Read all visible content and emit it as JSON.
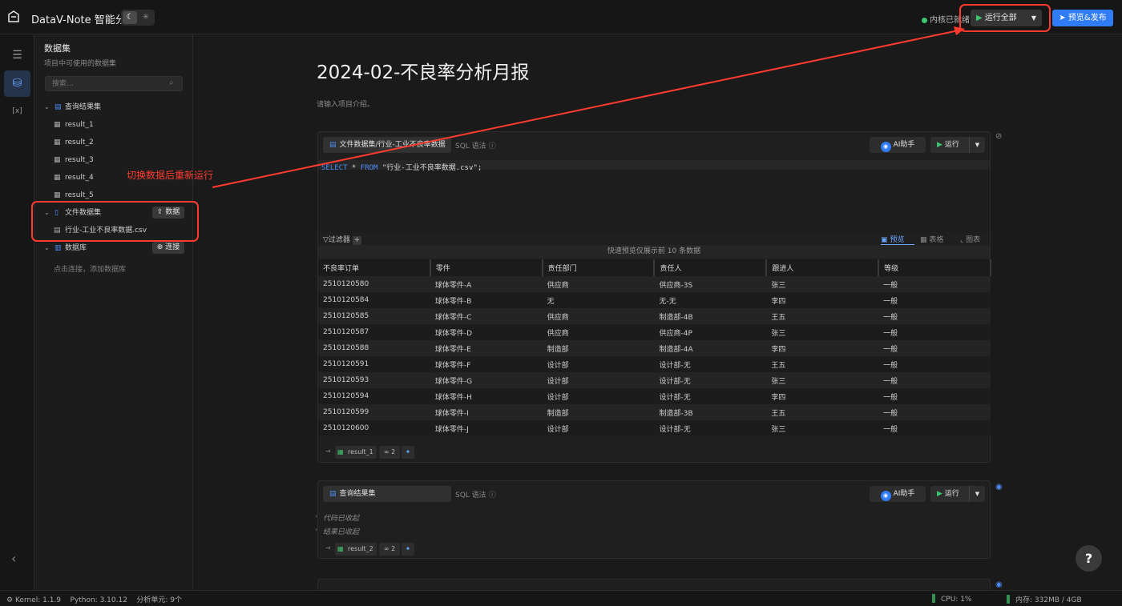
{
  "app": {
    "title": "DataV-Note 智能分析"
  },
  "header": {
    "kernel_status": "内核已就绪",
    "run_all_label": "运行全部",
    "publish_label": "预览&发布"
  },
  "sidebar": {
    "title": "数据集",
    "subtitle": "项目中可使用的数据集",
    "search_placeholder": "搜索...",
    "query_group": "查询结果集",
    "query_items": [
      "result_1",
      "result_2",
      "result_3",
      "result_4",
      "result_5"
    ],
    "file_group": "文件数据集",
    "file_upload_label": "数据",
    "file_items": [
      "行业-工业不良率数据.csv"
    ],
    "db_group": "数据库",
    "db_connect_label": "连接",
    "db_hint": "点击连接，添加数据库"
  },
  "document": {
    "title": "2024-02-不良率分析月报",
    "intro_placeholder": "请输入项目介绍。"
  },
  "cell1": {
    "source_tab": "文件数据集/行业-工业不良率数据",
    "mode_label": "SQL 语法",
    "ai_label": "AI助手",
    "run_label": "运行",
    "code": {
      "kw1": "SELECT",
      "star": " * ",
      "kw2": "FROM",
      "str": " \"行业-工业不良率数据.csv\";"
    },
    "filter_label": "过滤器",
    "views": {
      "preview": "预览",
      "table": "表格",
      "chart": "图表"
    },
    "preview_note": "快速预览仅展示前 10 条数据",
    "columns": [
      "不良率订单",
      "零件",
      "责任部门",
      "责任人",
      "跟进人",
      "等级"
    ],
    "rows": [
      [
        "2510120580",
        "球体零件-A",
        "供应商",
        "供应商-3S",
        "张三",
        "一般"
      ],
      [
        "2510120584",
        "球体零件-B",
        "无",
        "无-无",
        "李四",
        "一般"
      ],
      [
        "2510120585",
        "球体零件-C",
        "供应商",
        "制造部-4B",
        "王五",
        "一般"
      ],
      [
        "2510120587",
        "球体零件-D",
        "供应商",
        "供应商-4P",
        "张三",
        "一般"
      ],
      [
        "2510120588",
        "球体零件-E",
        "制造部",
        "制造部-4A",
        "李四",
        "一般"
      ],
      [
        "2510120591",
        "球体零件-F",
        "设计部",
        "设计部-无",
        "王五",
        "一般"
      ],
      [
        "2510120593",
        "球体零件-G",
        "设计部",
        "设计部-无",
        "张三",
        "一般"
      ],
      [
        "2510120594",
        "球体零件-H",
        "设计部",
        "设计部-无",
        "李四",
        "一般"
      ],
      [
        "2510120599",
        "球体零件-I",
        "制造部",
        "制造部-3B",
        "王五",
        "一般"
      ],
      [
        "2510120600",
        "球体零件-J",
        "设计部",
        "设计部-无",
        "张三",
        "一般"
      ]
    ],
    "result_chip": "result_1",
    "link_count": "2"
  },
  "cell2": {
    "source_tab": "查询结果集",
    "mode_label": "SQL 语法",
    "ai_label": "AI助手",
    "run_label": "运行",
    "code_collapsed": "代码已收起",
    "result_collapsed": "结果已收起",
    "result_chip": "result_2",
    "link_count": "2"
  },
  "annotation": {
    "text": "切换数据后重新运行",
    "color": "#ff3b30"
  },
  "statusbar": {
    "kernel": "Kernel: 1.1.9",
    "python": "Python: 3.10.12",
    "cells": "分析单元: 9个",
    "cpu": "CPU: 1%",
    "memory": "内存: 332MB / 4GB"
  },
  "colors": {
    "accent": "#2f7cf6",
    "success": "#3ec46d",
    "background": "#1a1a1a"
  }
}
